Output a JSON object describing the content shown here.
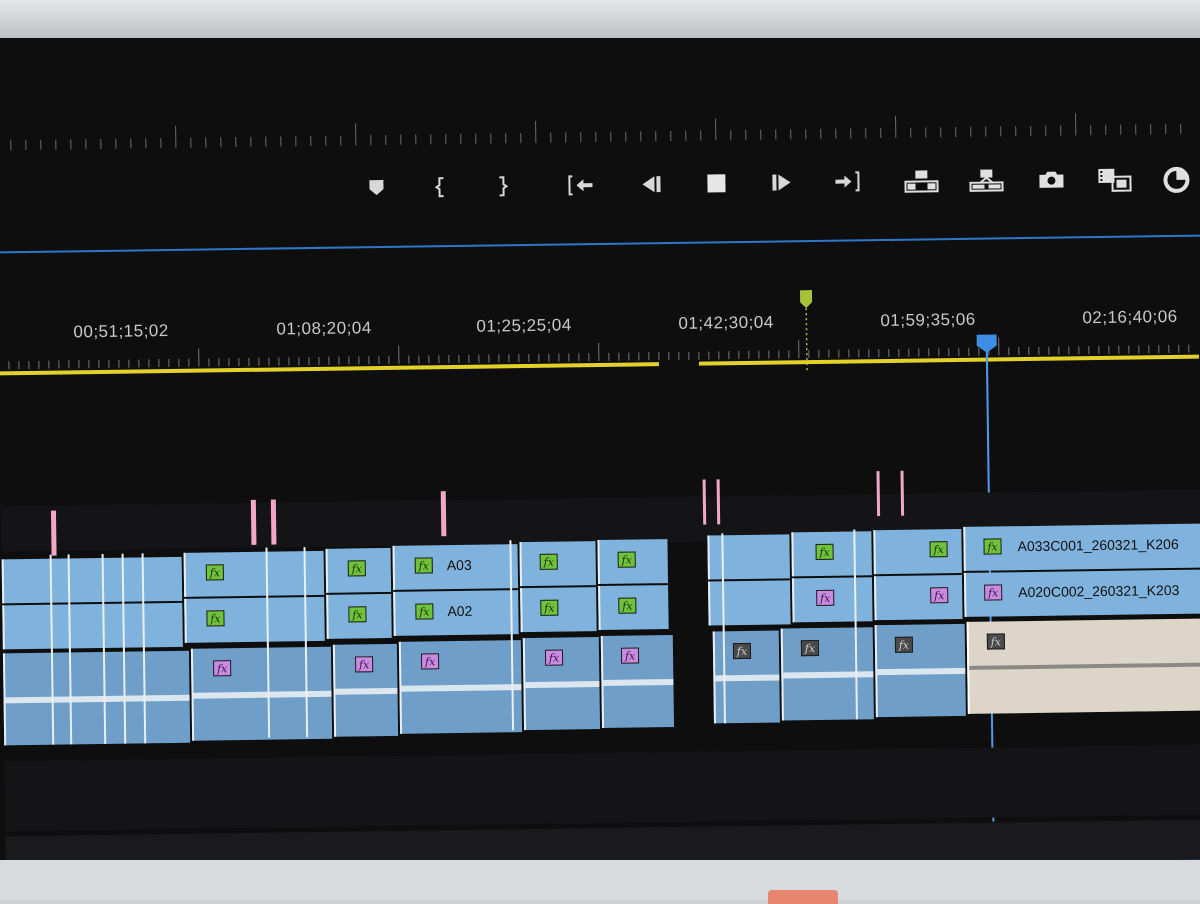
{
  "transport": {
    "buttons": [
      {
        "name": "add-marker",
        "icon": "marker-icon"
      },
      {
        "name": "mark-in",
        "icon": "mark-in-icon"
      },
      {
        "name": "mark-out",
        "icon": "mark-out-icon"
      },
      {
        "name": "go-to-in",
        "icon": "go-to-in-icon"
      },
      {
        "name": "step-back",
        "icon": "step-back-icon"
      },
      {
        "name": "stop",
        "icon": "stop-icon"
      },
      {
        "name": "step-forward",
        "icon": "step-forward-icon"
      },
      {
        "name": "go-to-out",
        "icon": "go-to-out-icon"
      },
      {
        "name": "lift",
        "icon": "lift-icon"
      },
      {
        "name": "extract",
        "icon": "extract-icon"
      },
      {
        "name": "export-frame",
        "icon": "camera-icon"
      },
      {
        "name": "comparison-view",
        "icon": "compare-icon"
      },
      {
        "name": "settings",
        "icon": "settings-icon"
      }
    ]
  },
  "timeline": {
    "timecodes": [
      "00;51;15;02",
      "01;08;20;04",
      "01;25;25;04",
      "01;42;30;04",
      "01;59;35;06",
      "02;16;40;06"
    ],
    "clips": {
      "v2_label_a": "A03",
      "v1_label_a": "A02",
      "v2_label_b": "A033C001_260321_K206",
      "v1_label_b": "A020C002_260321_K203"
    },
    "fx_text": "fx"
  },
  "colors": {
    "workarea": "#e2d128",
    "playhead": "#4e9bf0",
    "video_clip": "#7fb3dd",
    "audio_clip": "#6f9fc9",
    "marker_green": "#a8c23a",
    "marker_pink": "#f0a7c8"
  }
}
